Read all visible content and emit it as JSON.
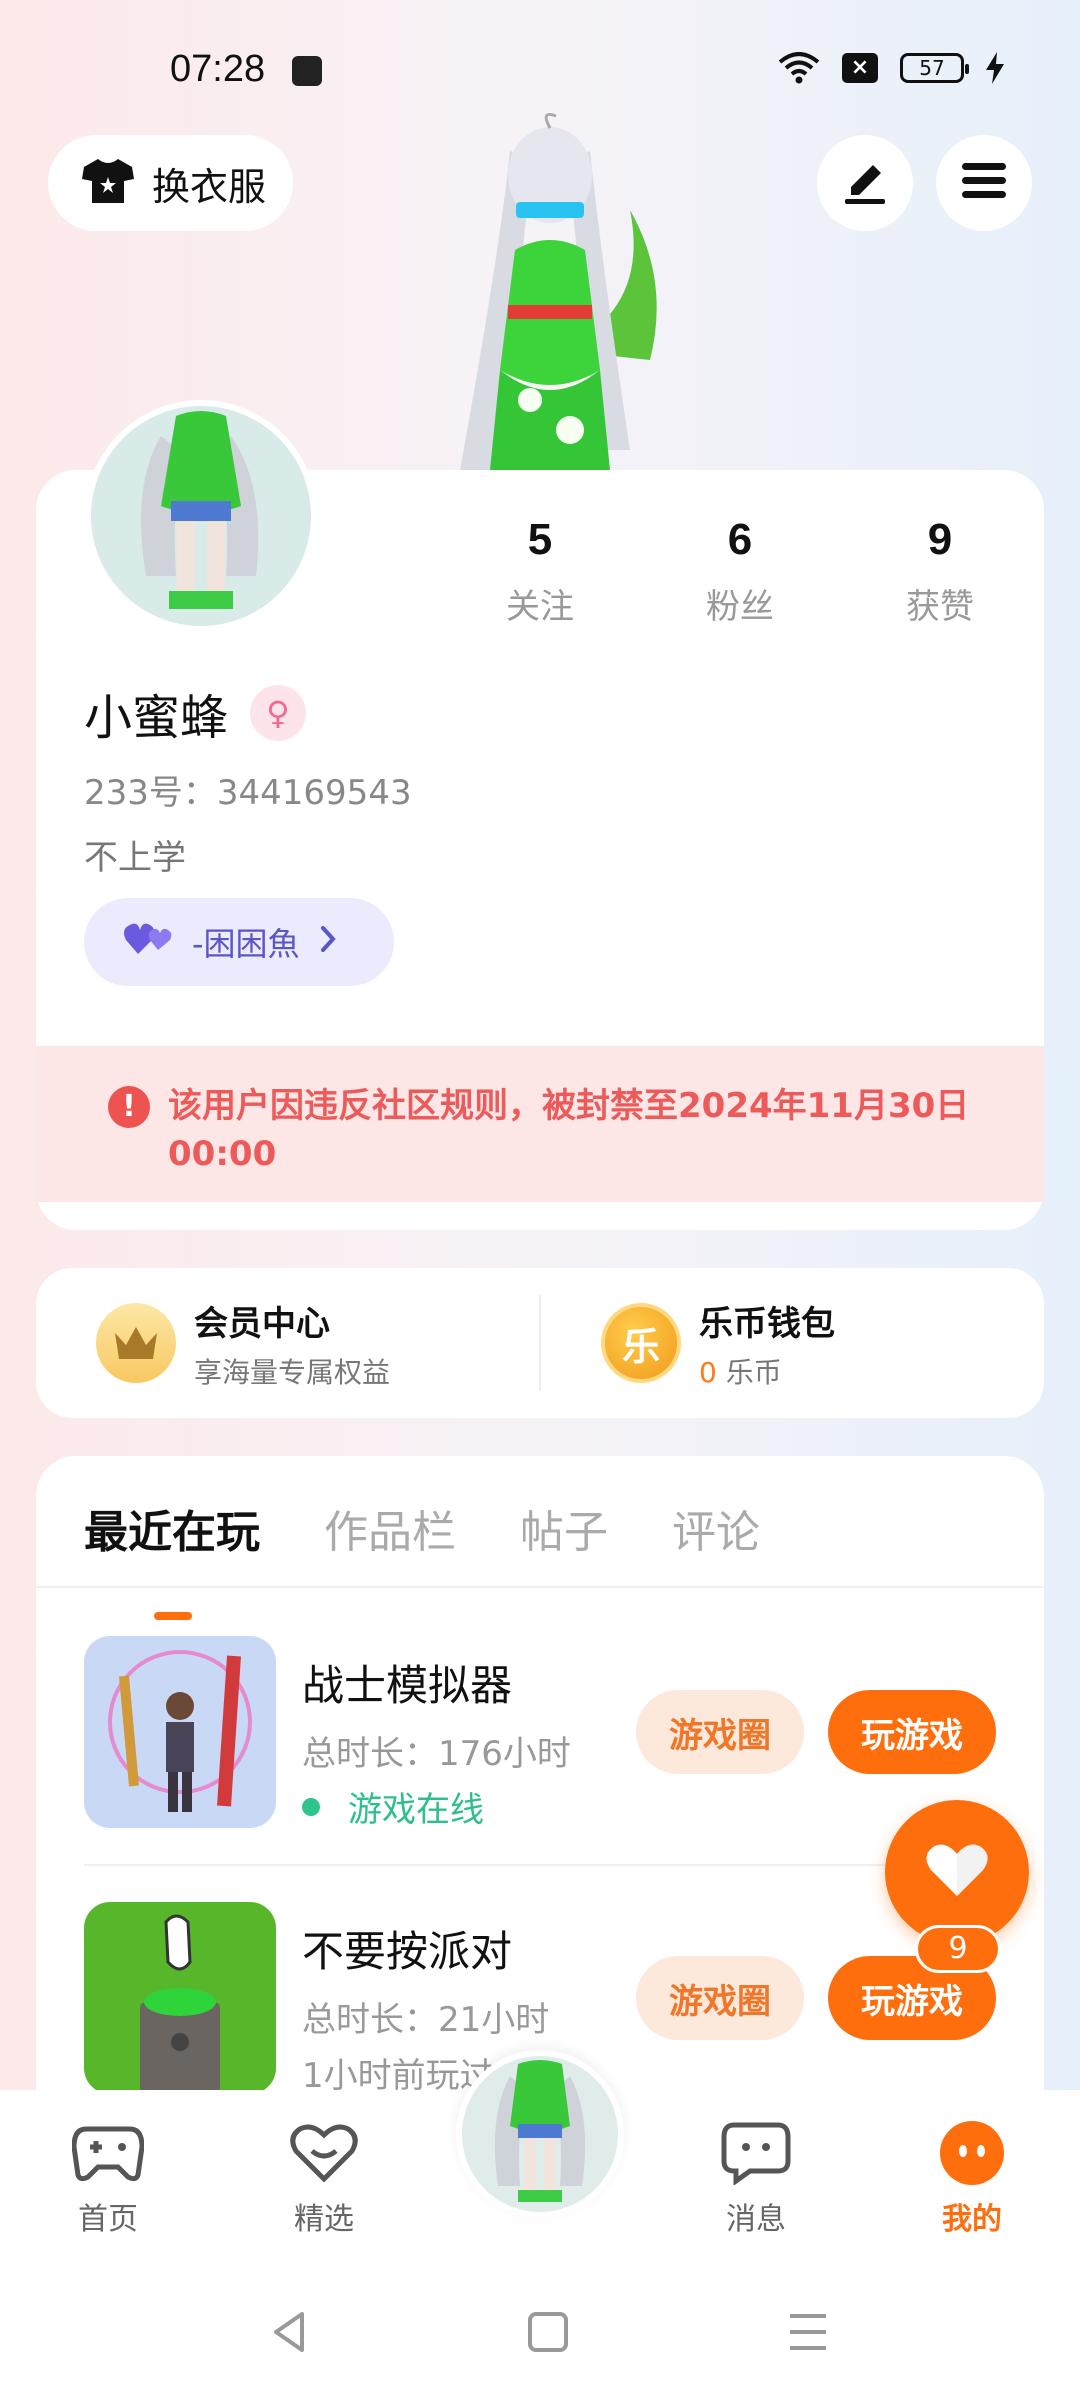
{
  "status_bar": {
    "time": "07:28",
    "battery": "57"
  },
  "header": {
    "outfit_label": "换衣服"
  },
  "profile": {
    "stats": [
      {
        "value": "5",
        "label": "关注"
      },
      {
        "value": "6",
        "label": "粉丝"
      },
      {
        "value": "9",
        "label": "获赞"
      }
    ],
    "nickname": "小蜜蜂",
    "uid": "233号：344169543",
    "bio": "不上学",
    "tag": "-困困魚",
    "ban_notice": "该用户因违反社区规则，被封禁至2024年11月30日 00:00"
  },
  "member": {
    "title": "会员中心",
    "subtitle": "享海量专属权益"
  },
  "wallet": {
    "title": "乐币钱包",
    "amount": "0",
    "unit": "乐币",
    "coin_glyph": "乐"
  },
  "tabs": [
    {
      "label": "最近在玩"
    },
    {
      "label": "作品栏"
    },
    {
      "label": "帖子"
    },
    {
      "label": "评论"
    }
  ],
  "games": [
    {
      "title": "战士模拟器",
      "duration": "总时长：176小时",
      "status": "游戏在线",
      "circle_label": "游戏圈",
      "play_label": "玩游戏"
    },
    {
      "title": "不要按派对",
      "duration": "总时长：21小时",
      "status": "1小时前玩过",
      "circle_label": "游戏圈",
      "play_label": "玩游戏"
    }
  ],
  "like_count": "9",
  "bottom_nav": [
    {
      "label": "首页"
    },
    {
      "label": "精选"
    },
    {
      "label": "消息"
    },
    {
      "label": "我的"
    }
  ],
  "colors": {
    "accent": "#ff6e0d",
    "ban_text": "#ec5a5a",
    "online": "#2fbf8c"
  }
}
